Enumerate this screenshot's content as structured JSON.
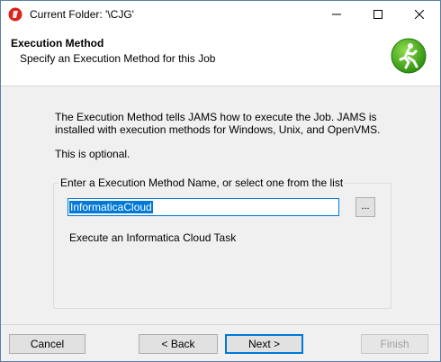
{
  "window": {
    "title": "Current Folder: '\\CJG'",
    "icons": {
      "app": "jams-app-icon",
      "minimize": "minimize-icon",
      "maximize": "maximize-icon",
      "close": "close-icon"
    }
  },
  "header": {
    "title": "Execution Method",
    "subtitle": "Specify an Execution Method for this Job",
    "icon": "running-man-icon",
    "icon_color": "#3aa81a"
  },
  "body": {
    "description": "The Execution Method tells JAMS how to execute the Job.  JAMS is installed with execution methods for Windows, Unix, and OpenVMS.",
    "optional_note": "This is optional.",
    "group_label": "Enter a Execution Method Name, or select one from the list",
    "method_value": "InformaticaCloud",
    "browse_label": "...",
    "method_description": "Execute an Informatica Cloud Task"
  },
  "footer": {
    "cancel_label": "Cancel",
    "back_label": "< Back",
    "next_label": "Next >",
    "finish_label": "Finish",
    "finish_enabled": false
  },
  "colors": {
    "accent": "#0078d7",
    "app_icon": "#d9251c"
  }
}
